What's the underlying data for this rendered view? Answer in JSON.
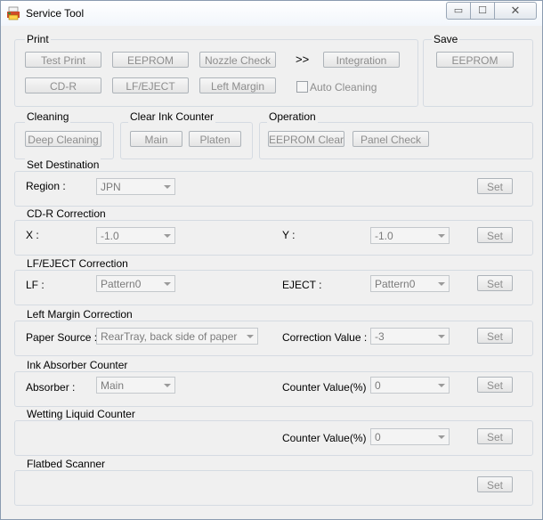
{
  "window": {
    "title": "Service Tool",
    "controls": {
      "minimize": "▭",
      "maximize": "☐",
      "close": "✕"
    }
  },
  "print": {
    "label": "Print",
    "buttons": {
      "test_print": "Test Print",
      "eeprom": "EEPROM",
      "nozzle_check": "Nozzle Check",
      "cd_r": "CD-R",
      "lf_eject": "LF/EJECT",
      "left_margin": "Left Margin",
      "integration": "Integration"
    },
    "arrows": ">>",
    "auto_cleaning": {
      "label": "Auto Cleaning",
      "checked": false
    }
  },
  "save": {
    "label": "Save",
    "eeprom": "EEPROM"
  },
  "cleaning": {
    "label": "Cleaning",
    "deep_cleaning": "Deep Cleaning"
  },
  "clear_ink_counter": {
    "label": "Clear Ink Counter",
    "main": "Main",
    "platen": "Platen"
  },
  "operation": {
    "label": "Operation",
    "eeprom_clear": "EEPROM Clear",
    "panel_check": "Panel Check"
  },
  "set_destination": {
    "label": "Set Destination",
    "region_label": "Region :",
    "region_value": "JPN",
    "set": "Set"
  },
  "cdr_correction": {
    "label": "CD-R Correction",
    "x_label": "X :",
    "x_value": "-1.0",
    "y_label": "Y :",
    "y_value": "-1.0",
    "set": "Set"
  },
  "lf_eject_correction": {
    "label": "LF/EJECT Correction",
    "lf_label": "LF :",
    "lf_value": "Pattern0",
    "eject_label": "EJECT :",
    "eject_value": "Pattern0",
    "set": "Set"
  },
  "left_margin_correction": {
    "label": "Left Margin Correction",
    "source_label": "Paper Source :",
    "source_value": "RearTray, back side of paper",
    "corr_label": "Correction Value :",
    "corr_value": "-3",
    "set": "Set"
  },
  "ink_absorber": {
    "label": "Ink Absorber Counter",
    "absorber_label": "Absorber :",
    "absorber_value": "Main",
    "counter_label": "Counter Value(%) :",
    "counter_value": "0",
    "set": "Set"
  },
  "wetting_liquid": {
    "label": "Wetting Liquid Counter",
    "counter_label": "Counter Value(%) :",
    "counter_value": "0",
    "set": "Set"
  },
  "flatbed": {
    "label": "Flatbed Scanner",
    "set": "Set"
  },
  "colors": {
    "disabled_text": "#8d8d8d",
    "group_border": "#d5dbe2",
    "window_bg": "#f0f0f0"
  }
}
